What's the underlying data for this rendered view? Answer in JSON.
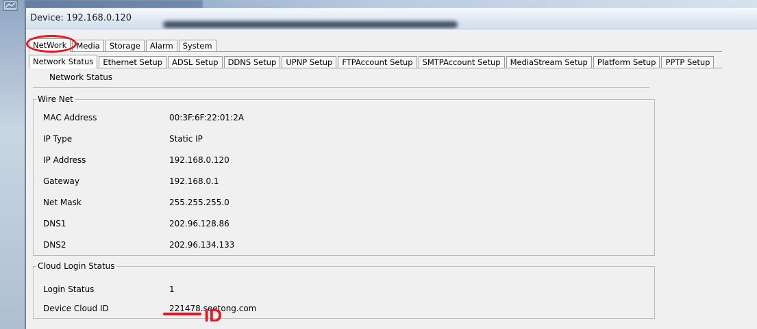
{
  "window": {
    "title": "Device: 192.168.0.120"
  },
  "tabs": [
    {
      "label": "NetWork",
      "active": true
    },
    {
      "label": "Media"
    },
    {
      "label": "Storage"
    },
    {
      "label": "Alarm"
    },
    {
      "label": "System"
    }
  ],
  "subtabs": [
    {
      "label": "Network Status",
      "active": true
    },
    {
      "label": "Ethernet Setup"
    },
    {
      "label": "ADSL Setup"
    },
    {
      "label": "DDNS Setup"
    },
    {
      "label": "UPNP Setup"
    },
    {
      "label": "FTPAccount Setup"
    },
    {
      "label": "SMTPAccount Setup"
    },
    {
      "label": "MediaStream Setup"
    },
    {
      "label": "Platform Setup"
    },
    {
      "label": "PPTP Setup"
    }
  ],
  "panel": {
    "title": "Network Status"
  },
  "wire_net": {
    "legend": "Wire Net",
    "rows": [
      {
        "label": "MAC Address",
        "value": "00:3F:6F:22:01:2A"
      },
      {
        "label": "IP Type",
        "value": "Static IP"
      },
      {
        "label": "IP Address",
        "value": "192.168.0.120"
      },
      {
        "label": "Gateway",
        "value": "192.168.0.1"
      },
      {
        "label": "Net Mask",
        "value": "255.255.255.0"
      },
      {
        "label": "DNS1",
        "value": "202.96.128.86"
      },
      {
        "label": "DNS2",
        "value": "202.96.134.133"
      }
    ]
  },
  "cloud": {
    "legend": "Cloud Login Status",
    "rows": [
      {
        "label": "Login Status",
        "value": "1"
      },
      {
        "label": "Device Cloud ID",
        "value": "221478.seetong.com"
      }
    ]
  },
  "annotation": {
    "text": "ID",
    "color": "#e8161b"
  },
  "colors": {
    "annotation": "#e8161b",
    "panel_bg": "#f0f0f0",
    "titlebar": "#dfe8f3"
  }
}
